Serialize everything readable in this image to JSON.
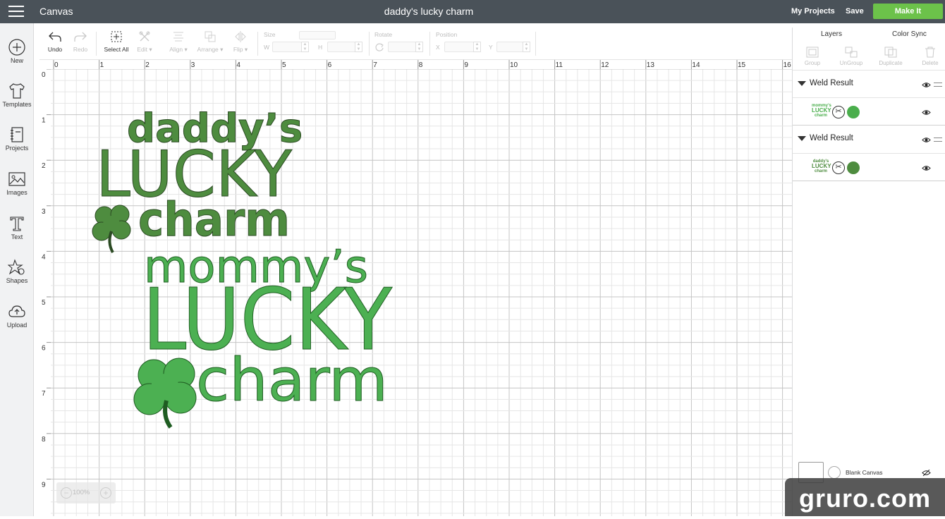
{
  "topbar": {
    "app_name": "Canvas",
    "project_title": "daddy's lucky charm",
    "my_projects": "My Projects",
    "save": "Save",
    "make_it": "Make It"
  },
  "sidebar": {
    "items": [
      {
        "label": "New",
        "icon": "plus-icon"
      },
      {
        "label": "Templates",
        "icon": "tshirt-icon"
      },
      {
        "label": "Projects",
        "icon": "notebook-icon"
      },
      {
        "label": "Images",
        "icon": "image-icon"
      },
      {
        "label": "Text",
        "icon": "text-icon"
      },
      {
        "label": "Shapes",
        "icon": "shapes-icon"
      },
      {
        "label": "Upload",
        "icon": "cloud-upload-icon"
      }
    ]
  },
  "toolbar": {
    "undo": "Undo",
    "redo": "Redo",
    "select_all": "Select All",
    "edit": "Edit",
    "align": "Align",
    "arrange": "Arrange",
    "flip": "Flip",
    "size_label": "Size",
    "w_label": "W",
    "h_label": "H",
    "rotate_label": "Rotate",
    "position_label": "Position",
    "x_label": "X",
    "y_label": "Y"
  },
  "ruler": {
    "top": [
      "0",
      "1",
      "2",
      "3",
      "4",
      "5",
      "6",
      "7",
      "8",
      "9",
      "10",
      "11",
      "12",
      "13",
      "14",
      "15",
      "16"
    ],
    "left": [
      "0",
      "1",
      "2",
      "3",
      "4",
      "5",
      "6",
      "7",
      "8",
      "9"
    ]
  },
  "design": {
    "daddy": {
      "line1": "daddy’s",
      "line2": "LUCKY",
      "line3": "charm",
      "color": "#4e8c3f"
    },
    "mommy": {
      "line1": "mommy’s",
      "line2": "LUCKY",
      "line3": "charm",
      "color": "#4cb052"
    }
  },
  "panel": {
    "tabs": {
      "layers": "Layers",
      "color_sync": "Color Sync"
    },
    "actions": {
      "group": "Group",
      "ungroup": "UnGroup",
      "duplicate": "Duplicate",
      "delete": "Delete"
    },
    "layers": [
      {
        "name": "Weld Result",
        "thumb_lines": [
          "mommy’s",
          "LUCKY",
          "charm"
        ],
        "color": "#4aae4c"
      },
      {
        "name": "Weld Result",
        "thumb_lines": [
          "daddy’s",
          "LUCKY",
          "charm"
        ],
        "color": "#4e8c3f"
      }
    ],
    "blank_canvas": "Blank Canvas"
  },
  "zoom": {
    "level": "100%"
  },
  "watermark": "gruro.com"
}
